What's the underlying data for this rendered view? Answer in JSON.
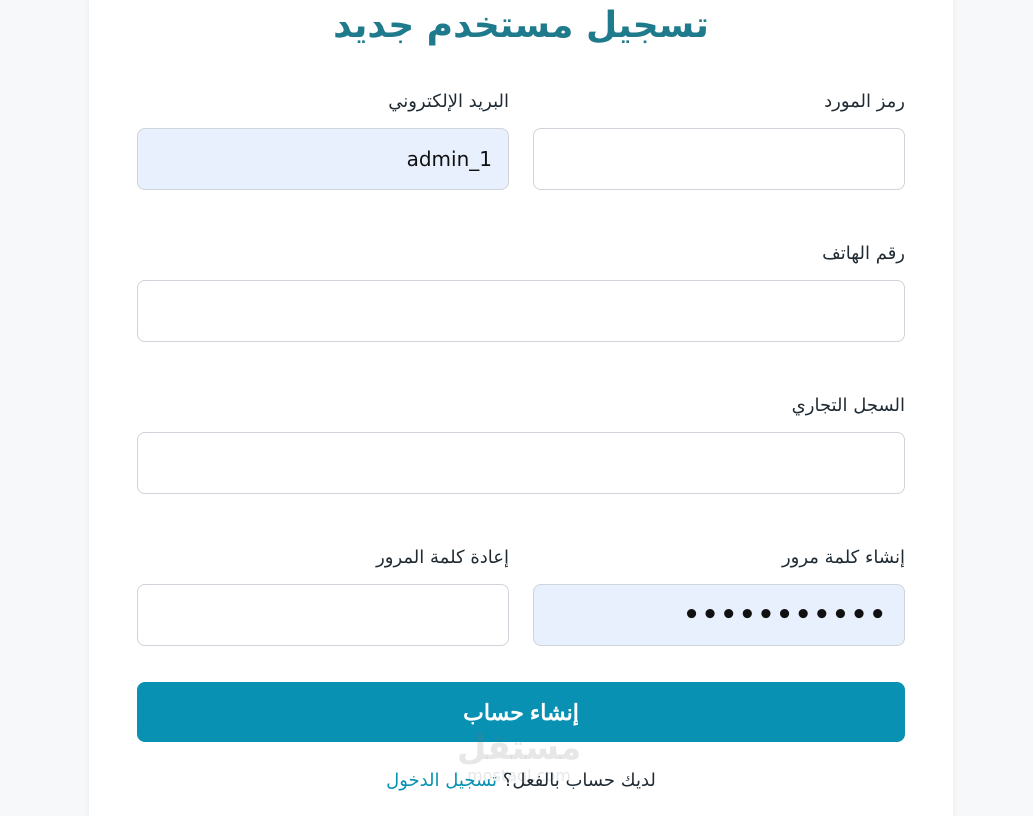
{
  "form": {
    "title": "تسجيل مستخدم جديد",
    "supplier_code": {
      "label": "رمز المورد",
      "value": ""
    },
    "email": {
      "label": "البريد الإلكتروني",
      "value": "admin_1"
    },
    "phone": {
      "label": "رقم الهاتف",
      "value": ""
    },
    "commercial_register": {
      "label": "السجل التجاري",
      "value": ""
    },
    "create_password": {
      "label": "إنشاء كلمة مرور",
      "value": "•••••••••••"
    },
    "confirm_password": {
      "label": "إعادة كلمة المرور",
      "value": ""
    },
    "submit_label": "إنشاء حساب",
    "footer_text": "لديك حساب بالفعل؟",
    "login_link": "تسجيل الدخول"
  },
  "watermark": {
    "brand": "مستقل",
    "site": "mostaql.com"
  },
  "colors": {
    "accent": "#0891b2",
    "title": "#1f7a8c",
    "autofill": "#e8f0fe"
  }
}
